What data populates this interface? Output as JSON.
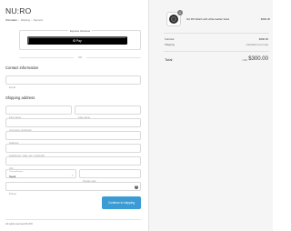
{
  "header": {
    "store_name": "NU:RO",
    "breadcrumbs": [
      "Information",
      "Shipping",
      "Payment"
    ]
  },
  "express_checkout": {
    "title": "Express checkout",
    "button_label": "Pay",
    "button_icon": "google-g-icon"
  },
  "divider_text": "OR",
  "contact": {
    "title": "Contact information",
    "email_placeholder": "Email"
  },
  "shipping": {
    "title": "Shipping address",
    "first_name_placeholder": "First name",
    "last_name_placeholder": "Last name",
    "company_placeholder": "Company (optional)",
    "address_placeholder": "Address",
    "apartment_placeholder": "Apartment, suite, etc. (optional)",
    "city_placeholder": "City",
    "country_label": "Country/Region",
    "country_value": "Nepal",
    "postal_placeholder": "Postal code",
    "phone_placeholder": "Phone"
  },
  "continue_label": "Continue to shipping",
  "footer_text": "All rights reserved NU:RO",
  "order": {
    "item_name": "NU:RO Watch with white leather band",
    "item_qty": "1",
    "item_price": "$300.00",
    "subtotal_label": "Subtotal",
    "subtotal_value": "$300.00",
    "shipping_label": "Shipping",
    "shipping_value": "Calculated at next step",
    "total_label": "Total",
    "currency": "USD",
    "total_value": "$300.00"
  },
  "colors": {
    "accent": "#3a9bd5",
    "sidebar_bg": "#f5f5f5"
  }
}
